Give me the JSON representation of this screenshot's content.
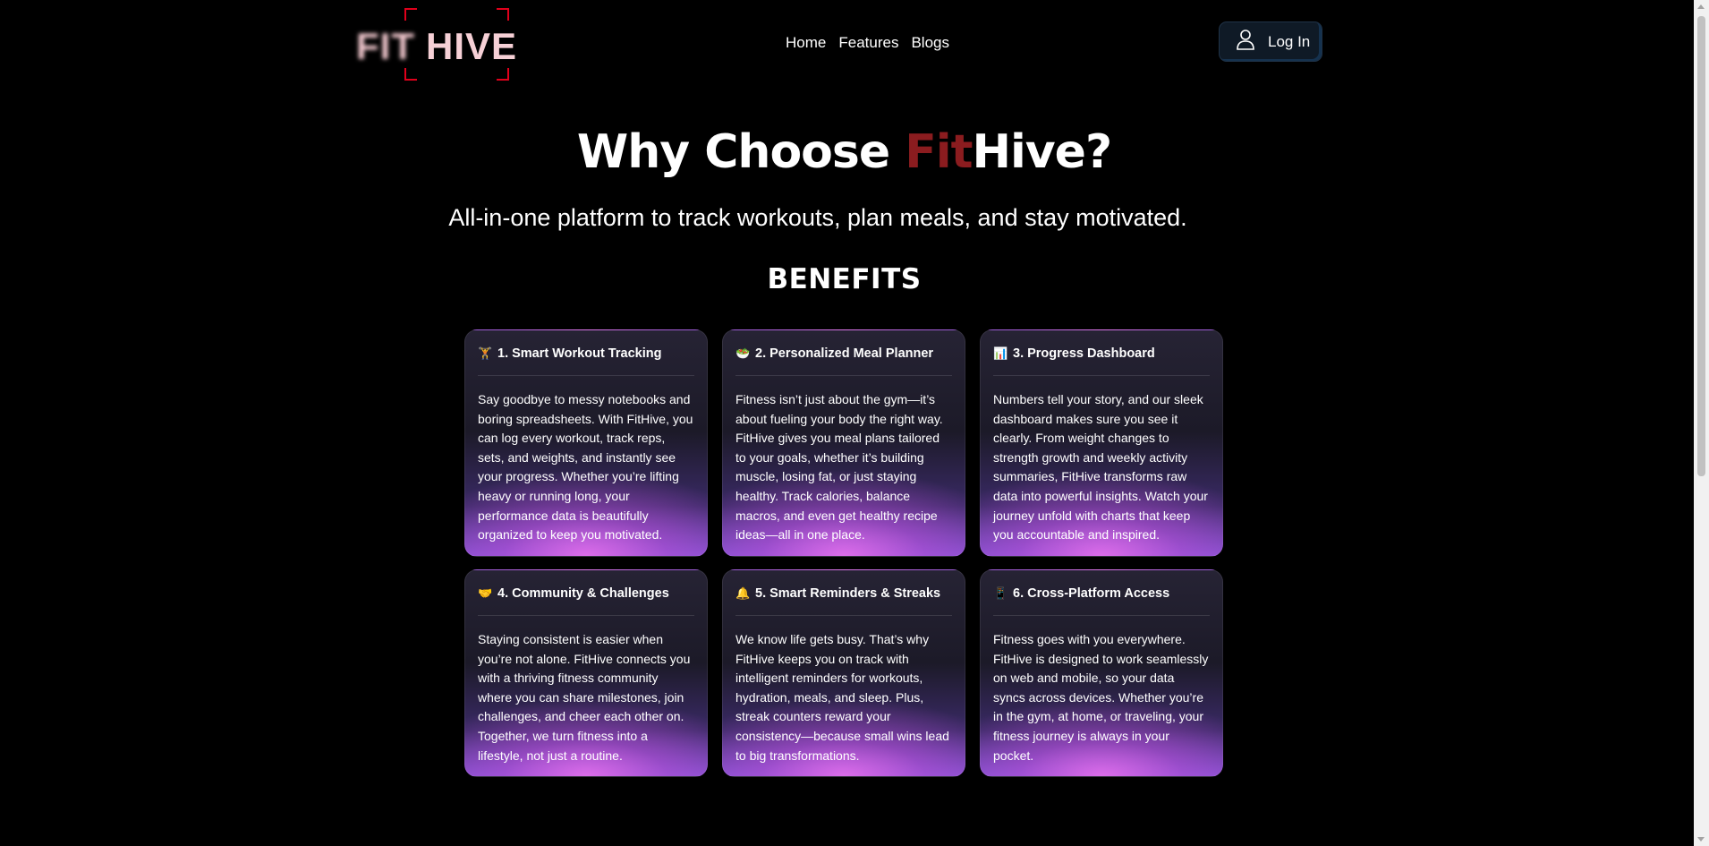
{
  "logo": {
    "part1": "FIT",
    "part2": "HIVE"
  },
  "nav": {
    "items": [
      "Home",
      "Features",
      "Blogs"
    ]
  },
  "login": {
    "label": "Log In"
  },
  "hero": {
    "title_prefix": "Why Choose ",
    "title_accent": "Fit",
    "title_suffix": "Hive?",
    "subtitle": "All-in-one platform to track workouts, plan meals, and stay motivated."
  },
  "benefits": {
    "heading": "BENEFITS",
    "cards": [
      {
        "emoji": "🏋",
        "title": "1. Smart Workout Tracking",
        "text": "Say goodbye to messy notebooks and boring spreadsheets. With FitHive, you can log every workout, track reps, sets, and weights, and instantly see your progress. Whether you’re lifting heavy or running long, your performance data is beautifully organized to keep you motivated."
      },
      {
        "emoji": "🥗",
        "title": "2. Personalized Meal Planner",
        "text": "Fitness isn’t just about the gym—it’s about fueling your body the right way. FitHive gives you meal plans tailored to your goals, whether it’s building muscle, losing fat, or just staying healthy. Track calories, balance macros, and even get healthy recipe ideas—all in one place."
      },
      {
        "emoji": "📊",
        "title": "3. Progress Dashboard",
        "text": "Numbers tell your story, and our sleek dashboard makes sure you see it clearly. From weight changes to strength growth and weekly activity summaries, FitHive transforms raw data into powerful insights. Watch your journey unfold with charts that keep you accountable and inspired."
      },
      {
        "emoji": "🤝",
        "title": "4. Community & Challenges",
        "text": "Staying consistent is easier when you’re not alone. FitHive connects you with a thriving fitness community where you can share milestones, join challenges, and cheer each other on. Together, we turn fitness into a lifestyle, not just a routine."
      },
      {
        "emoji": "🔔",
        "title": "5. Smart Reminders & Streaks",
        "text": "We know life gets busy. That’s why FitHive keeps you on track with intelligent reminders for workouts, hydration, meals, and sleep. Plus, streak counters reward your consistency—because small wins lead to big transformations."
      },
      {
        "emoji": "📱",
        "title": "6. Cross-Platform Access",
        "text": "Fitness goes with you everywhere. FitHive is designed to work seamlessly on web and mobile, so your data syncs across devices. Whether you’re in the gym, at home, or traveling, your fitness journey is always in your pocket."
      }
    ]
  }
}
